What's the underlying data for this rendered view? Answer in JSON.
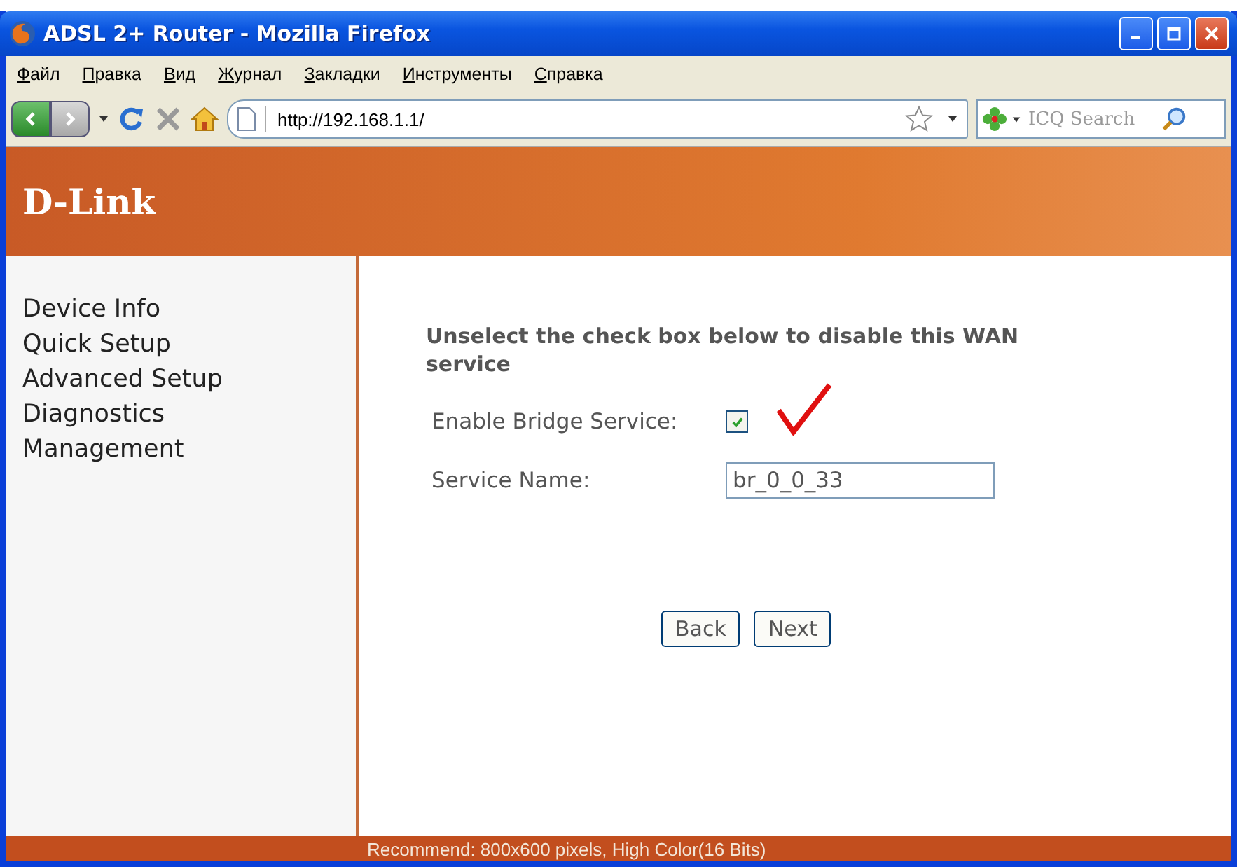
{
  "window": {
    "title": "ADSL 2+ Router - Mozilla Firefox"
  },
  "menu": [
    "Файл",
    "Правка",
    "Вид",
    "Журнал",
    "Закладки",
    "Инструменты",
    "Справка"
  ],
  "toolbar": {
    "address": "http://192.168.1.1/",
    "search_placeholder": "ICQ Search"
  },
  "banner": {
    "logo": "D-Link"
  },
  "sidebar": {
    "items": [
      "Device Info",
      "Quick Setup",
      "Advanced Setup",
      "Diagnostics",
      "Management"
    ]
  },
  "form": {
    "instruction": "Unselect the check box below to disable this WAN service",
    "bridge": {
      "label": "Enable Bridge Service:",
      "checked": true
    },
    "service_name": {
      "label": "Service Name:",
      "value": "br_0_0_33"
    },
    "buttons": [
      "Back",
      "Next"
    ]
  },
  "footer": "Recommend: 800x600 pixels, High Color(16 Bits)"
}
